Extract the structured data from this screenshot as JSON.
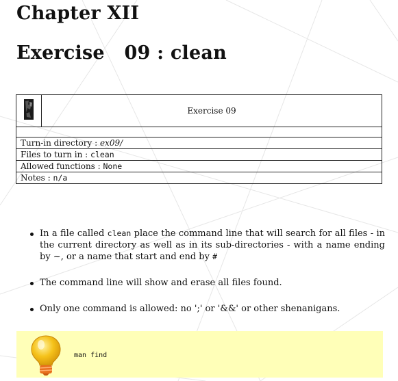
{
  "chapter_title": "Chapter XII",
  "exercise_title": "Exercise   09 : clean",
  "info_table": {
    "header_title": "Exercise  09",
    "rows": [
      {
        "label": "Turn-in directory : ",
        "value": "ex09/",
        "style": "italic"
      },
      {
        "label": "Files to turn in : ",
        "value": "clean",
        "style": "mono"
      },
      {
        "label": "Allowed functions : ",
        "value": "None",
        "style": "mono"
      },
      {
        "label": "Notes : ",
        "value": "n/a",
        "style": "mono"
      }
    ]
  },
  "bullets": [
    {
      "parts": [
        {
          "text": "In a file called ",
          "mono": false
        },
        {
          "text": "clean",
          "mono": true
        },
        {
          "text": " place the command line that will search for all files - in the current directory as well as in its sub-directories - with a name ending by ~, or a name that start and end by ",
          "mono": false
        },
        {
          "text": "#",
          "mono": true
        }
      ]
    },
    {
      "parts": [
        {
          "text": "The command line will show and erase all files found.",
          "mono": false
        }
      ]
    },
    {
      "parts": [
        {
          "text": "Only one command is allowed: no ';' or '&&' or other shenanigans.",
          "mono": false
        }
      ]
    }
  ],
  "hint": {
    "text": "man find",
    "icon": "lightbulb-icon"
  },
  "colors": {
    "hint_background": "#ffffb8",
    "bulb_yellow": "#f5c21a",
    "bulb_orange": "#e8701e"
  }
}
